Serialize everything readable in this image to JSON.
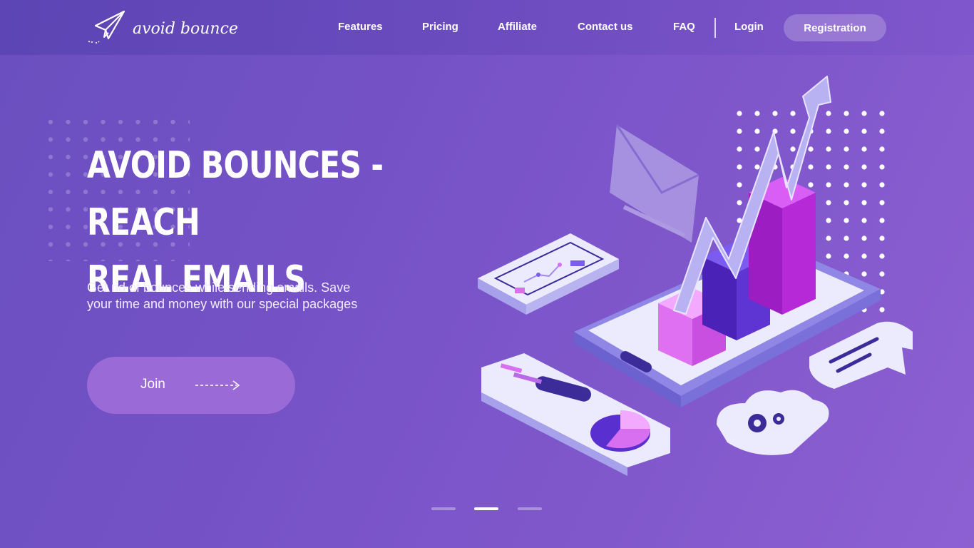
{
  "brand": {
    "name": "avoid bounce",
    "logo_icon": "paper-plane-icon"
  },
  "nav": {
    "items": [
      {
        "label": "Features"
      },
      {
        "label": "Pricing"
      },
      {
        "label": "Affiliate"
      },
      {
        "label": "Contact us"
      },
      {
        "label": "FAQ"
      },
      {
        "label": "Login"
      }
    ],
    "registration_label": "Registration"
  },
  "hero": {
    "title_line1": "AVOID BOUNCES - REACH",
    "title_line2": "REAL EMAILS",
    "subtitle_line1": "Get rid of bounces while sending emails. Save",
    "subtitle_line2": "your time and money with our special packages",
    "join_label": "Join",
    "join_icon": "dashed-arrow-right-icon",
    "illustration_icons": [
      "envelope-icon",
      "bar-chart-icon",
      "trend-arrow-icon",
      "pie-chart-icon",
      "gear-icon",
      "speech-bubble-icon",
      "phone-icon"
    ]
  },
  "slider": {
    "count": 3,
    "active_index": 1
  },
  "colors": {
    "background": "#7452c6",
    "button": "#9a6ad6",
    "bar_pink": "#d86ff0",
    "bar_purple": "#5a2fd0",
    "bar_magenta": "#b02bd0",
    "card": "#e8e4fb"
  }
}
